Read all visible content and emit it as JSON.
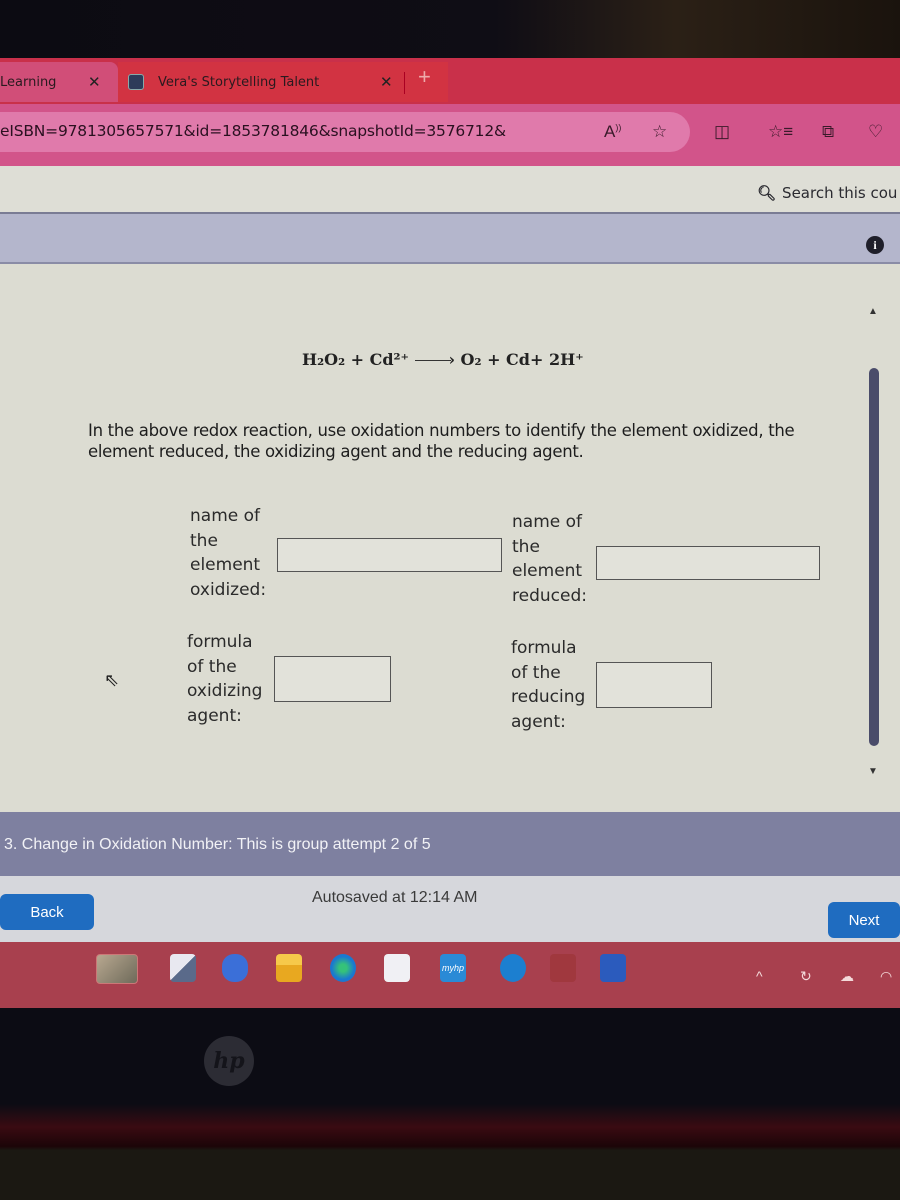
{
  "browser": {
    "tabs": [
      {
        "label": "Learning",
        "active": true
      },
      {
        "label": "Vera's Storytelling Talent",
        "active": false
      }
    ],
    "close_glyph": "✕",
    "new_tab_glyph": "+",
    "url": "eISBN=9781305657571&id=1853781846&snapshotId=3576712&",
    "toolbar_icons": [
      "read-aloud-icon",
      "favorite-star-icon",
      "split-screen-icon",
      "favorites-list-icon",
      "collections-icon",
      "browser-essentials-icon"
    ]
  },
  "course": {
    "search_label": "Search this cou",
    "info_glyph": "i"
  },
  "question": {
    "equation": {
      "reactants": "H₂O₂ + Cd²⁺",
      "products": "O₂ + Cd+ 2H⁺"
    },
    "prompt": "In the above redox reaction, use oxidation numbers to identify the element oxidized, the element reduced, the oxidizing agent and the reducing agent.",
    "fields": [
      {
        "label_lines": [
          "name of",
          "the",
          "element",
          "oxidized:"
        ],
        "value": ""
      },
      {
        "label_lines": [
          "name of",
          "the",
          "element",
          "reduced:"
        ],
        "value": ""
      },
      {
        "label_lines": [
          "formula",
          "of the",
          "oxidizing",
          "agent:"
        ],
        "value": ""
      },
      {
        "label_lines": [
          "formula",
          "of the",
          "reducing",
          "agent:"
        ],
        "value": ""
      }
    ]
  },
  "footer": {
    "title": "3. Change in Oxidation Number: This is group attempt 2 of 5",
    "back_label": "Back",
    "next_label": "Next",
    "autosave": "Autosaved at 12:14 AM"
  },
  "taskbar": {
    "apps": [
      "photos",
      "task-view",
      "teams-meet",
      "file-explorer",
      "edge",
      "microsoft-store",
      "myhp",
      "get-help",
      "mcafee",
      "word"
    ],
    "myhp_label": "myhp",
    "tray_chevron": "^"
  },
  "bezel": {
    "logo": "hp"
  }
}
